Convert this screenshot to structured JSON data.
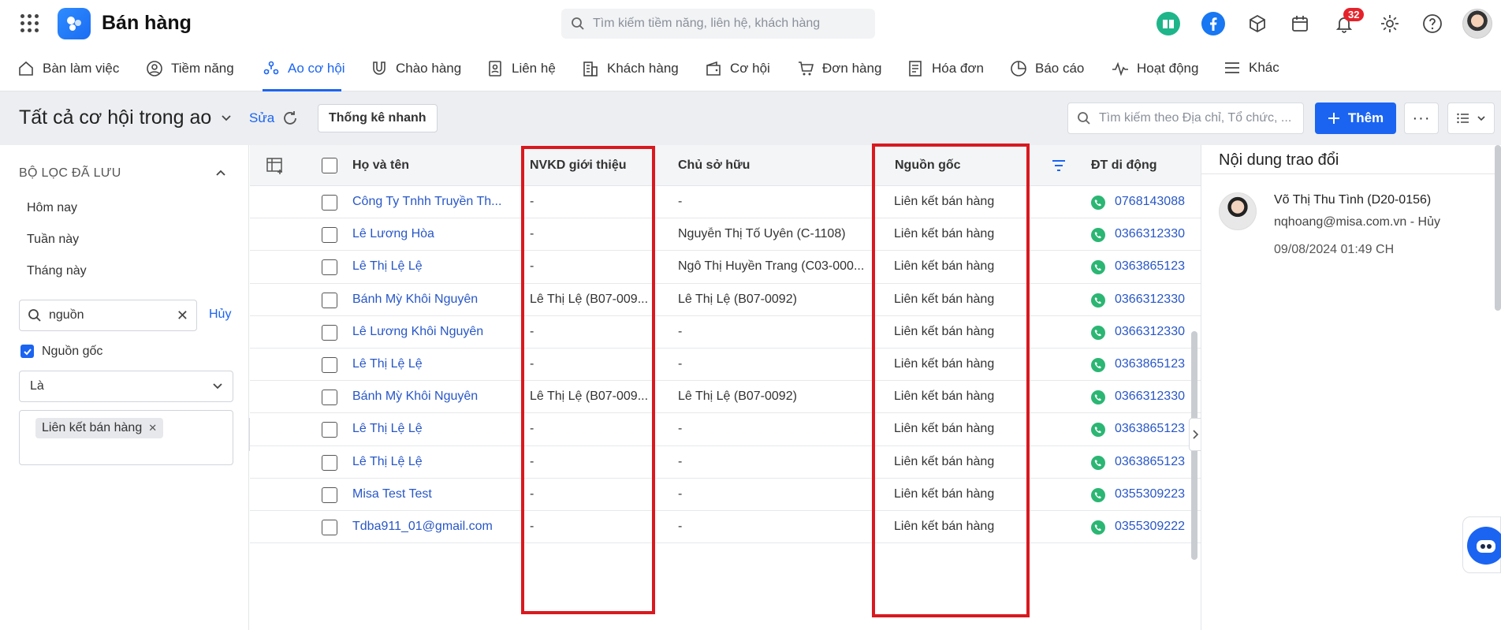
{
  "app": {
    "title": "Bán hàng"
  },
  "global_search": {
    "placeholder": "Tìm kiếm tiềm năng, liên hệ, khách hàng"
  },
  "notifications": {
    "count": "32"
  },
  "nav": [
    {
      "label": "Bàn làm việc",
      "icon": "home-icon"
    },
    {
      "label": "Tiềm năng",
      "icon": "user-circle-icon"
    },
    {
      "label": "Ao cơ hội",
      "icon": "pool-icon",
      "active": true
    },
    {
      "label": "Chào hàng",
      "icon": "magnet-icon"
    },
    {
      "label": "Liên hệ",
      "icon": "contact-icon"
    },
    {
      "label": "Khách hàng",
      "icon": "building-icon"
    },
    {
      "label": "Cơ hội",
      "icon": "wallet-icon"
    },
    {
      "label": "Đơn hàng",
      "icon": "cart-icon"
    },
    {
      "label": "Hóa đơn",
      "icon": "invoice-icon"
    },
    {
      "label": "Báo cáo",
      "icon": "pie-chart-icon"
    },
    {
      "label": "Hoạt động",
      "icon": "activity-icon"
    },
    {
      "label": "Khác",
      "icon": "menu-icon"
    }
  ],
  "header": {
    "title": "Tất cả cơ hội trong ao",
    "edit_label": "Sửa",
    "quick_stats_label": "Thống kê nhanh",
    "search_placeholder": "Tìm kiếm theo Địa chỉ, Tổ chức, ...",
    "add_label": "Thêm",
    "more_label": "···"
  },
  "filters": {
    "saved_title": "BỘ LỌC ĐÃ LƯU",
    "saved_items": [
      "Hôm nay",
      "Tuần này",
      "Tháng này"
    ],
    "field_search_value": "nguồn",
    "cancel_label": "Hủy",
    "field_label": "Nguồn gốc",
    "field_checked": true,
    "operator": "Là",
    "values": [
      "Liên kết bán hàng"
    ]
  },
  "table": {
    "columns": [
      "Họ và tên",
      "NVKD giới thiệu",
      "Chủ sở hữu",
      "Nguồn gốc",
      "ĐT di động"
    ],
    "rows": [
      {
        "name": "Công Ty Tnhh Truyền Th...",
        "referrer": "-",
        "owner": "-",
        "source": "Liên kết bán hàng",
        "phone": "0768143088"
      },
      {
        "name": "Lê Lương Hòa",
        "referrer": "-",
        "owner": "Nguyễn Thị Tố Uyên (C-1108)",
        "source": "Liên kết bán hàng",
        "phone": "0366312330"
      },
      {
        "name": "Lê Thị Lệ Lệ",
        "referrer": "-",
        "owner": "Ngô Thị Huyền Trang (C03-000...",
        "source": "Liên kết bán hàng",
        "phone": "0363865123"
      },
      {
        "name": "Bánh Mỳ Khôi Nguyên",
        "referrer": "Lê Thị Lệ (B07-009...",
        "owner": "Lê Thị Lệ (B07-0092)",
        "source": "Liên kết bán hàng",
        "phone": "0366312330"
      },
      {
        "name": "Lê Lương Khôi Nguyên",
        "referrer": "-",
        "owner": "-",
        "source": "Liên kết bán hàng",
        "phone": "0366312330"
      },
      {
        "name": "Lê Thị Lệ Lệ",
        "referrer": "-",
        "owner": "-",
        "source": "Liên kết bán hàng",
        "phone": "0363865123"
      },
      {
        "name": "Bánh Mỳ Khôi Nguyên",
        "referrer": "Lê Thị Lệ (B07-009...",
        "owner": "Lê Thị Lệ (B07-0092)",
        "source": "Liên kết bán hàng",
        "phone": "0366312330"
      },
      {
        "name": "Lê Thị Lệ Lệ",
        "referrer": "-",
        "owner": "-",
        "source": "Liên kết bán hàng",
        "phone": "0363865123"
      },
      {
        "name": "Lê Thị Lệ Lệ",
        "referrer": "-",
        "owner": "-",
        "source": "Liên kết bán hàng",
        "phone": "0363865123"
      },
      {
        "name": "Misa Test Test",
        "referrer": "-",
        "owner": "-",
        "source": "Liên kết bán hàng",
        "phone": "0355309223"
      },
      {
        "name": "Tdba911_01@gmail.com",
        "referrer": "-",
        "owner": "-",
        "source": "Liên kết bán hàng",
        "phone": "0355309222"
      }
    ]
  },
  "right_panel": {
    "title": "Nội dung trao đổi",
    "entry": {
      "name": "Võ Thị Thu Tình (D20-0156)",
      "email": "nqhoang@misa.com.vn - Hủy",
      "time": "09/08/2024 01:49 CH"
    }
  },
  "colors": {
    "accent": "#1b64f2",
    "highlight": "#d9191f",
    "link": "#2857c7",
    "phone": "#2bb673"
  }
}
